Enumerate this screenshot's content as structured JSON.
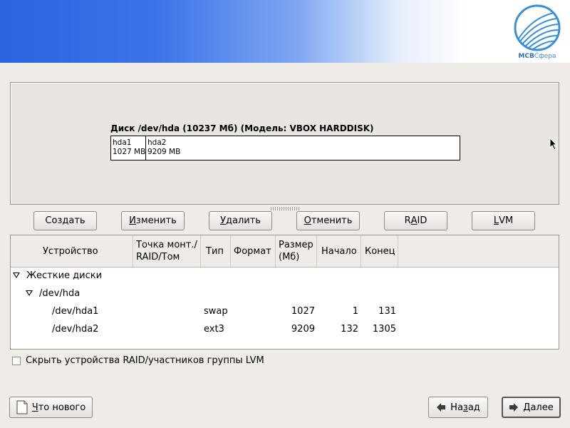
{
  "logo": {
    "brand_a": "МСВ",
    "brand_b": "Сфера"
  },
  "disk": {
    "title": "Диск /dev/hda (10237 Мб) (Модель: VBOX HARDDISK)",
    "partitions": [
      {
        "name": "hda1",
        "size": "1027 MB"
      },
      {
        "name": "hda2",
        "size": "9209 MB"
      }
    ]
  },
  "toolbar": {
    "create": "Создать",
    "edit_u": "И",
    "edit_rest": "зменить",
    "delete_u": "У",
    "delete_rest": "далить",
    "undo_u": "О",
    "undo_rest": "тменить",
    "raid_a": "R",
    "raid_u": "A",
    "raid_b": "ID",
    "lvm_u": "L",
    "lvm_rest": "VM"
  },
  "table": {
    "headers": {
      "device": "Устройство",
      "mount_1": "Точка монт./",
      "mount_2": "RAID/Том",
      "type": "Тип",
      "format": "Формат",
      "size_1": "Размер",
      "size_2": "(Мб)",
      "start": "Начало",
      "end": "Конец"
    },
    "group": "Жесткие диски",
    "disk": "/dev/hda",
    "rows": [
      {
        "device": "/dev/hda1",
        "mount": "",
        "type": "swap",
        "size": "1027",
        "start": "1",
        "end": "131"
      },
      {
        "device": "/dev/hda2",
        "mount": "",
        "type": "ext3",
        "size": "9209",
        "start": "132",
        "end": "1305"
      }
    ]
  },
  "hide_checkbox": {
    "label": "Скрыть устройства RAID/участников группы LVM",
    "checked": false
  },
  "footer": {
    "whats_new_u": "Ч",
    "whats_new_rest": "то нового",
    "back_a": "На",
    "back_u": "з",
    "back_b": "ад",
    "next_u": "Д",
    "next_rest": "алее"
  },
  "colors": {
    "banner": "#2a63e0",
    "logo": "#2f6fb0"
  },
  "icons": [
    "mouse-pointer-icon",
    "document-icon",
    "arrow-left-icon",
    "arrow-right-icon",
    "expander-icon",
    "logo-icon"
  ]
}
